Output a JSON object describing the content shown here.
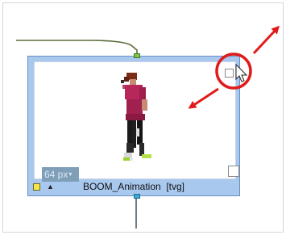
{
  "node": {
    "name": "BOOM_Animation  [tvg]",
    "zoom_value": "64 px",
    "zoom_caret": "▾",
    "triangle_glyph": "▲"
  },
  "icons": {
    "zoom_caret": "caret-down-icon",
    "display_toggle": "triangle-icon",
    "color_swatch": "color-swatch-icon",
    "cursor": "cursor-icon",
    "resize_arrows": "diagonal-resize-arrows-icon"
  },
  "colors": {
    "node_frame": "#a9c8ee",
    "highlight": "#e01b1b",
    "input_port": "#7fc24c",
    "output_port": "#3fa6d6",
    "swatch": "#f6e64b",
    "wire_in": "#5a6b3a",
    "wire_out": "#4d5b6a"
  }
}
